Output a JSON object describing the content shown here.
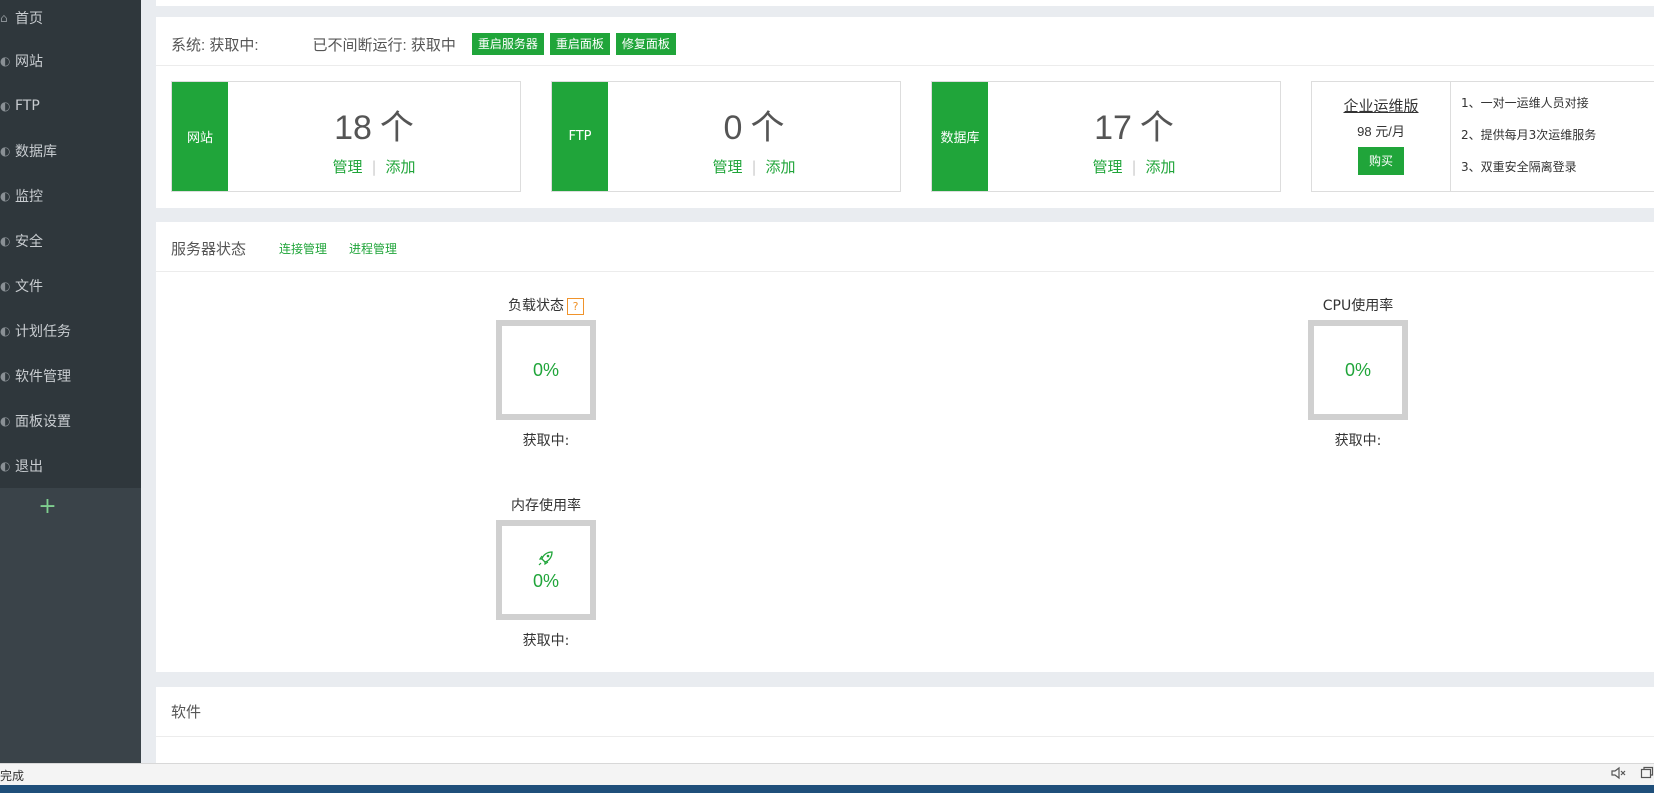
{
  "sidebar": {
    "items": [
      {
        "label": "首页",
        "icon": "home-icon",
        "glyph": "⌂"
      },
      {
        "label": "网站",
        "icon": "globe-icon",
        "glyph": "◐"
      },
      {
        "label": "FTP",
        "icon": "ftp-icon",
        "glyph": "◐"
      },
      {
        "label": "数据库",
        "icon": "database-icon",
        "glyph": "◐"
      },
      {
        "label": "监控",
        "icon": "monitor-icon",
        "glyph": "◐"
      },
      {
        "label": "安全",
        "icon": "shield-icon",
        "glyph": "◐"
      },
      {
        "label": "文件",
        "icon": "folder-icon",
        "glyph": "◐"
      },
      {
        "label": "计划任务",
        "icon": "calendar-icon",
        "glyph": "◐"
      },
      {
        "label": "软件管理",
        "icon": "apps-icon",
        "glyph": "◐"
      },
      {
        "label": "面板设置",
        "icon": "gear-icon",
        "glyph": "◐"
      },
      {
        "label": "退出",
        "icon": "logout-icon",
        "glyph": "◐"
      }
    ],
    "add": "+"
  },
  "system": {
    "label": "系统: 获取中:",
    "uptime": "已不间断运行: 获取中",
    "buttons": [
      "重启服务器",
      "重启面板",
      "修复面板"
    ]
  },
  "cards": [
    {
      "tag": "网站",
      "count": "18",
      "unit": "个",
      "manage": "管理",
      "sep": "|",
      "add": "添加"
    },
    {
      "tag": "FTP",
      "count": "0",
      "unit": "个",
      "manage": "管理",
      "sep": "|",
      "add": "添加"
    },
    {
      "tag": "数据库",
      "count": "17",
      "unit": "个",
      "manage": "管理",
      "sep": "|",
      "add": "添加"
    }
  ],
  "promo": {
    "title": "企业运维版",
    "price": "98 元/月",
    "buy": "购买",
    "features": [
      "1、一对一运维人员对接",
      "2、提供每月3次运维服务",
      "3、双重安全隔离登录"
    ]
  },
  "status": {
    "title": "服务器状态",
    "links": [
      "连接管理",
      "进程管理"
    ],
    "gauges": {
      "load": {
        "title": "负载状态",
        "help": "?",
        "value": "0%",
        "sub": "获取中:"
      },
      "cpu": {
        "title": "CPU使用率",
        "value": "0%",
        "sub": "获取中:"
      },
      "mem": {
        "title": "内存使用率",
        "value": "0%",
        "sub": "获取中:",
        "icon": "rocket-icon"
      }
    }
  },
  "software": {
    "title": "软件"
  },
  "statusbar": {
    "text": "完成"
  },
  "colors": {
    "accent": "#20a53a",
    "sidebar": "#3a4349",
    "help": "#f0932b"
  }
}
